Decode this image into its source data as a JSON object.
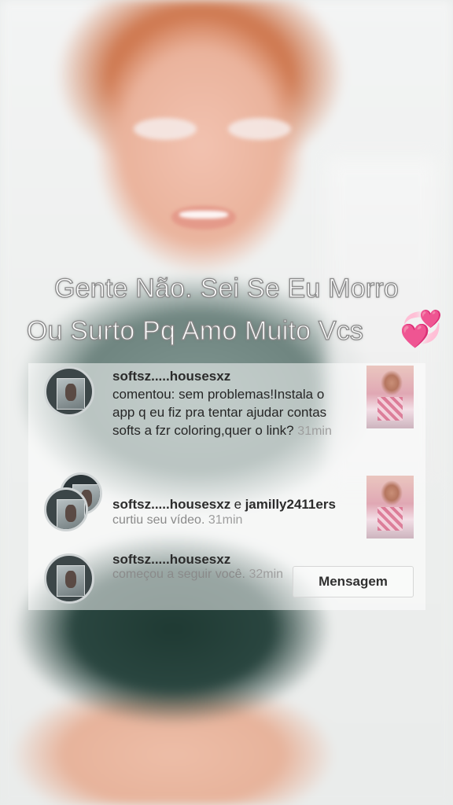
{
  "caption": {
    "line1": "Gente Não. Sei Se Eu Morro",
    "line2": "Ou Surto Pq Amo Muito Vcs",
    "emoji": "💞"
  },
  "notifications": [
    {
      "user": "softsz.....housesxz",
      "text": "comentou: sem problemas!Instala o app q eu fiz pra tentar ajudar contas softs a fzr coloring,quer o link?",
      "time": "31min"
    },
    {
      "user": "softsz.....housesxz",
      "connector": "e",
      "user2": "jamilly2411ers",
      "text": "curtiu seu vídeo.",
      "time": "31min"
    },
    {
      "user": "softsz.....housesxz",
      "text": "começou a seguir você.",
      "time": "32min",
      "button": "Mensagem"
    }
  ],
  "icons": {
    "avatar": "profile-avatar",
    "thumb": "video-thumbnail"
  }
}
